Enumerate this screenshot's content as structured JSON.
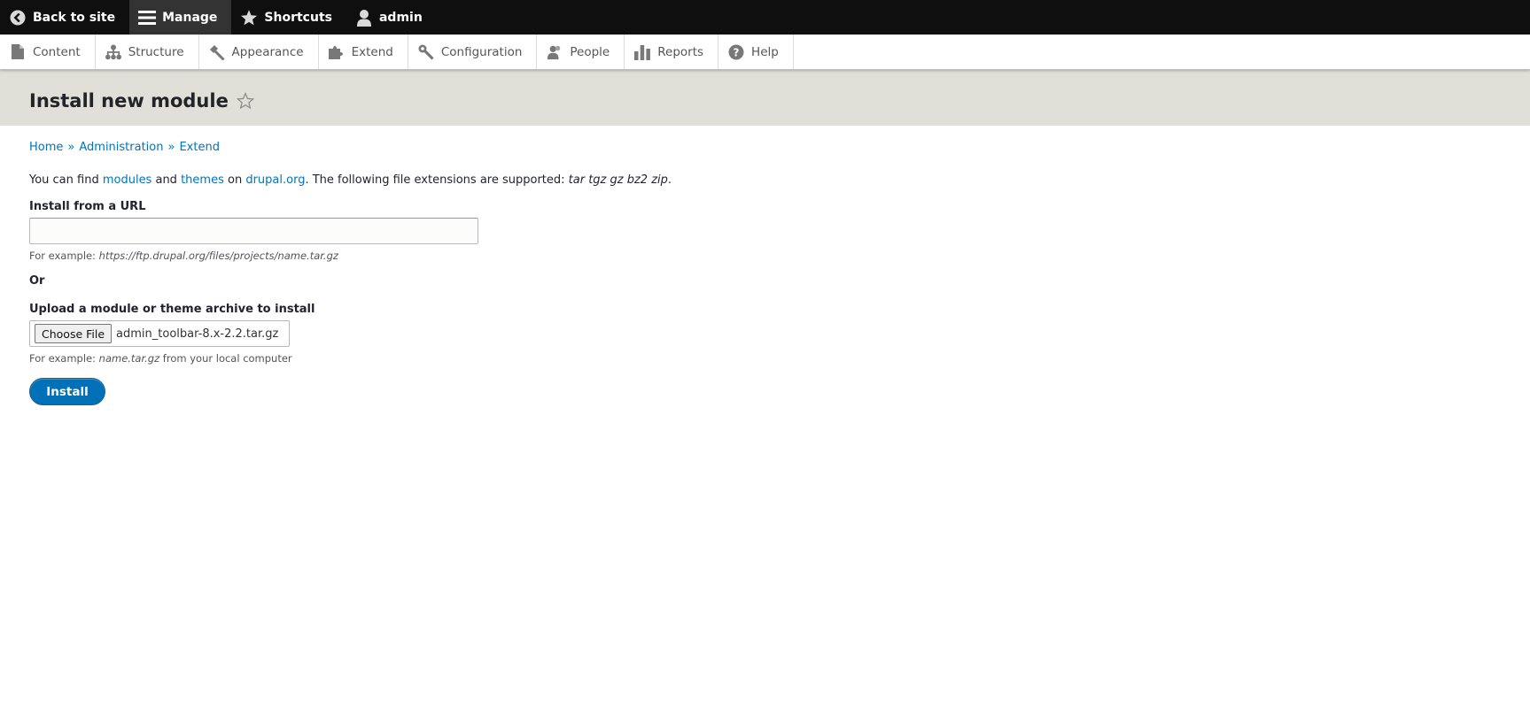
{
  "toolbar": {
    "back_to_site": "Back to site",
    "manage": "Manage",
    "shortcuts": "Shortcuts",
    "user": "admin"
  },
  "tray": {
    "items": [
      {
        "label": "Content",
        "icon": "file-icon"
      },
      {
        "label": "Structure",
        "icon": "sitemap-icon"
      },
      {
        "label": "Appearance",
        "icon": "paintbrush-icon"
      },
      {
        "label": "Extend",
        "icon": "puzzle-icon"
      },
      {
        "label": "Configuration",
        "icon": "wrench-icon"
      },
      {
        "label": "People",
        "icon": "people-icon"
      },
      {
        "label": "Reports",
        "icon": "bar-chart-icon"
      },
      {
        "label": "Help",
        "icon": "help-icon"
      }
    ]
  },
  "page": {
    "title": "Install new module"
  },
  "breadcrumb": {
    "home": "Home",
    "sep": "»",
    "administration": "Administration",
    "extend": "Extend"
  },
  "help": {
    "prefix": "You can find ",
    "modules": "modules",
    "and": " and ",
    "themes": "themes",
    "on": " on ",
    "drupal": "drupal.org",
    "suffix": ". The following file extensions are supported: ",
    "extensions": "tar tgz gz bz2 zip",
    "end": "."
  },
  "form": {
    "url_label": "Install from a URL",
    "url_value": "",
    "url_desc_prefix": "For example: ",
    "url_desc_example": "https://ftp.drupal.org/files/projects/name.tar.gz",
    "or_label": "Or",
    "upload_label": "Upload a module or theme archive to install",
    "choose_file": "Choose File",
    "file_name": "admin_toolbar-8.x-2.2.tar.gz",
    "upload_desc_prefix": "For example: ",
    "upload_desc_example": "name.tar.gz",
    "upload_desc_suffix": " from your local computer",
    "submit": "Install"
  },
  "colors": {
    "toolbar_bg": "#0f0f0f",
    "link": "#0074bd",
    "button_primary": "#0071b8",
    "header_band": "#e0e0d8"
  }
}
